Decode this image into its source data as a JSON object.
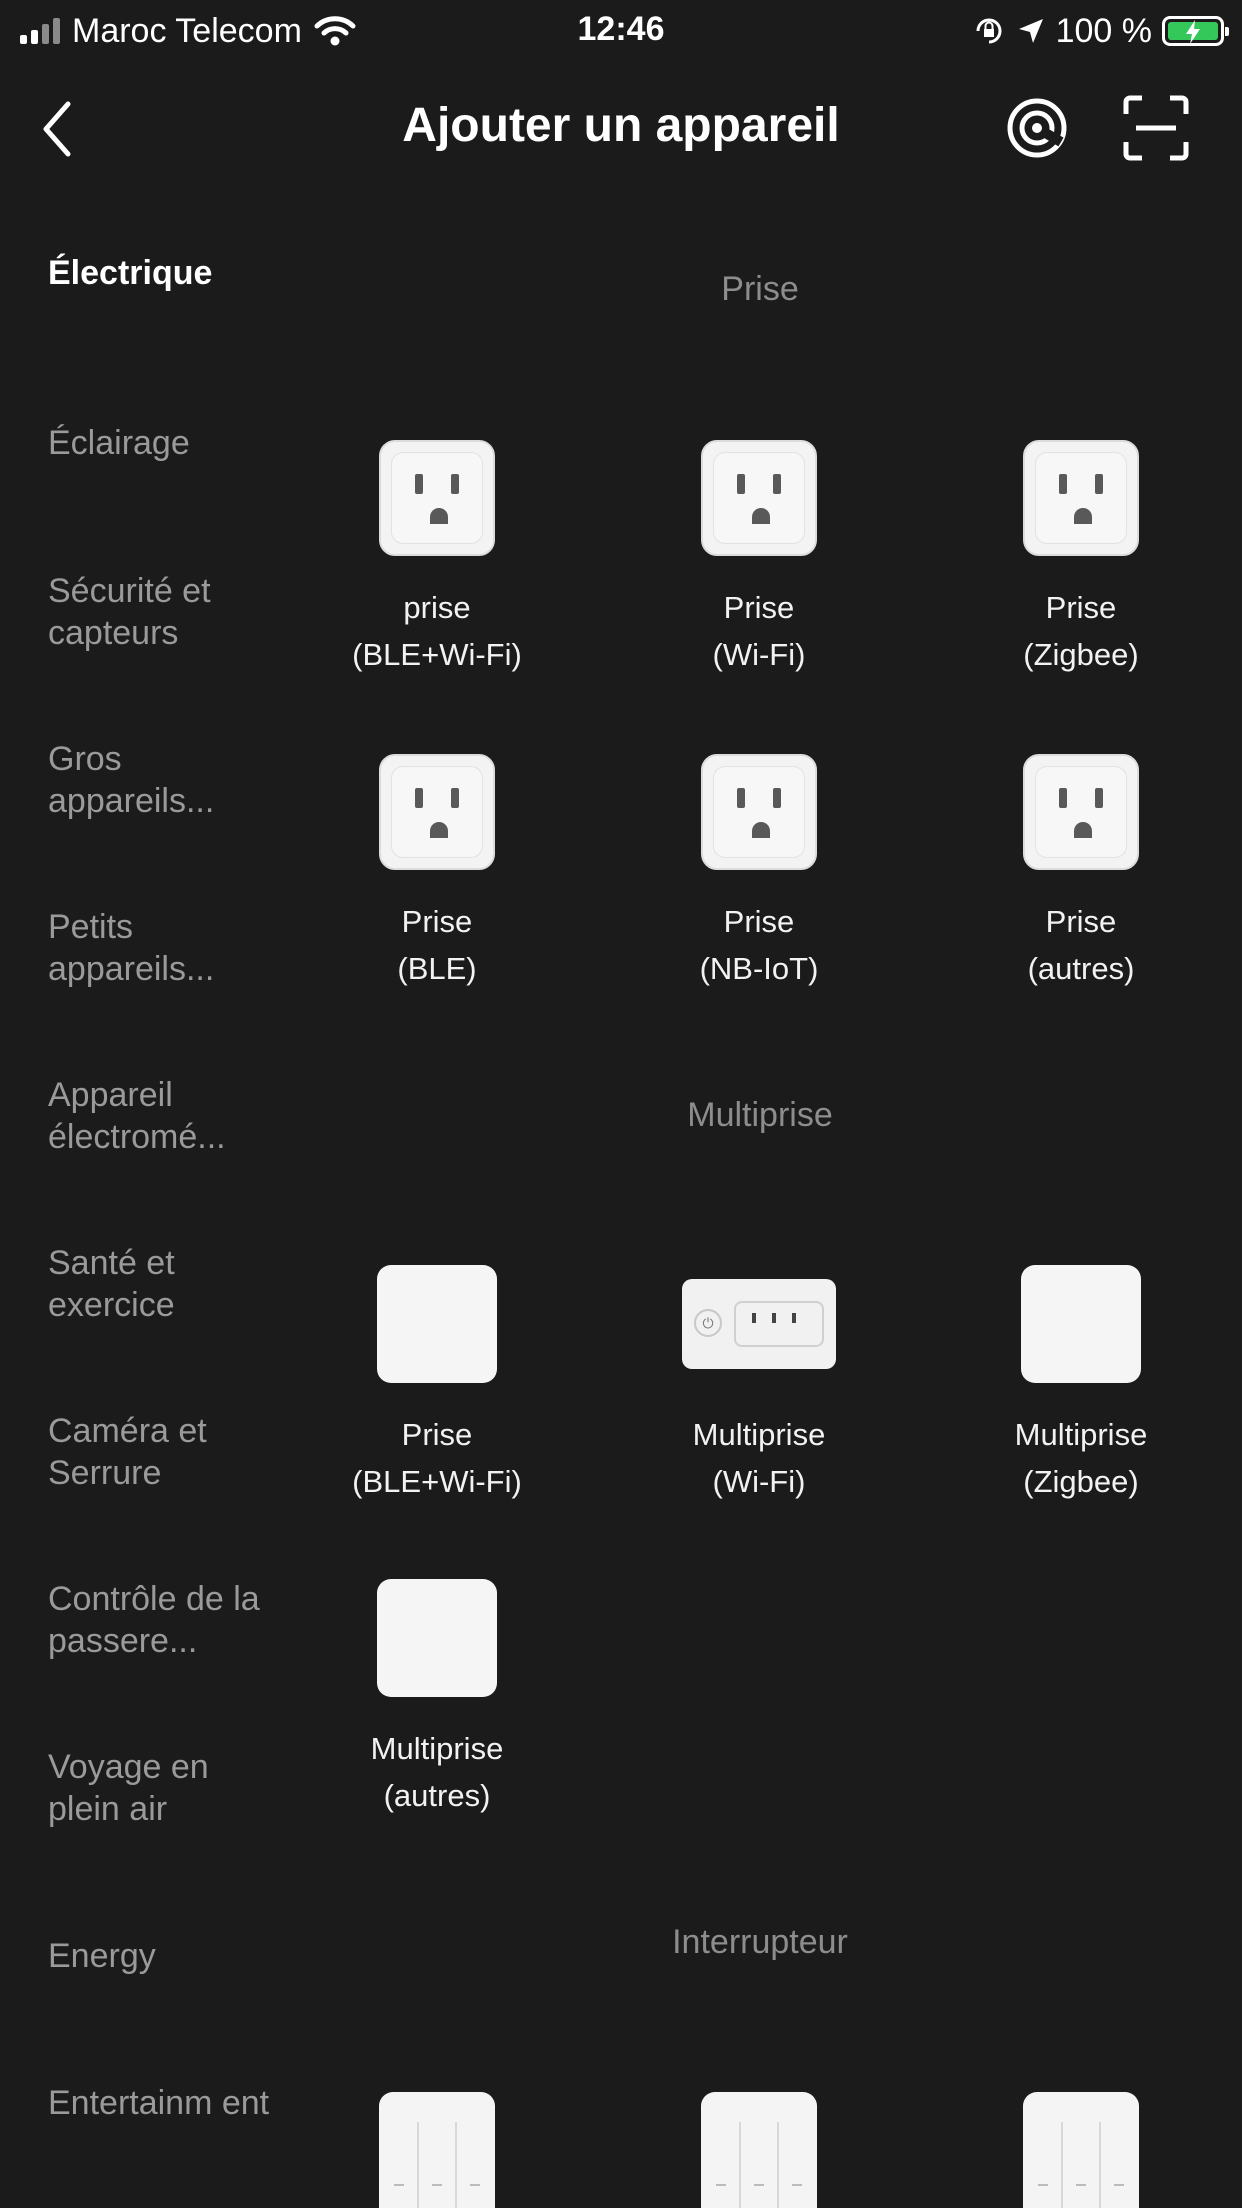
{
  "status_bar": {
    "carrier": "Maroc Telecom",
    "time": "12:46",
    "battery_text": "100 %",
    "icons": [
      "signal-icon",
      "wifi-icon",
      "orientation-lock-icon",
      "location-arrow-icon",
      "battery-charging-icon"
    ]
  },
  "nav": {
    "title": "Ajouter un appareil",
    "back_icon": "chevron-left-icon",
    "scan_icon": "radar-scan-icon",
    "qr_icon": "qr-scan-icon"
  },
  "sidebar": {
    "items": [
      {
        "label": "Électrique",
        "active": true
      },
      {
        "label": "Éclairage"
      },
      {
        "label": "Sécurité et capteurs"
      },
      {
        "label": "Gros appareils..."
      },
      {
        "label": "Petits appareils..."
      },
      {
        "label": "Appareil électromé..."
      },
      {
        "label": "Santé et exercice"
      },
      {
        "label": "Caméra et Serrure"
      },
      {
        "label": "Contrôle de la passere..."
      },
      {
        "label": "Voyage en plein air"
      },
      {
        "label": "Energy"
      },
      {
        "label": "Entertainm ent"
      }
    ]
  },
  "sections": [
    {
      "title": "Prise",
      "devices": [
        {
          "line1": "prise",
          "line2": "(BLE+Wi-Fi)",
          "icon": "outlet-icon"
        },
        {
          "line1": "Prise",
          "line2": "(Wi-Fi)",
          "icon": "outlet-icon"
        },
        {
          "line1": "Prise",
          "line2": "(Zigbee)",
          "icon": "outlet-icon"
        },
        {
          "line1": "Prise",
          "line2": "(BLE)",
          "icon": "outlet-icon"
        },
        {
          "line1": "Prise",
          "line2": "(NB-IoT)",
          "icon": "outlet-icon"
        },
        {
          "line1": "Prise",
          "line2": "(autres)",
          "icon": "outlet-icon"
        }
      ]
    },
    {
      "title": "Multiprise",
      "devices": [
        {
          "line1": "Prise",
          "line2": "(BLE+Wi-Fi)",
          "icon": "blank-device-icon"
        },
        {
          "line1": "Multiprise",
          "line2": "(Wi-Fi)",
          "icon": "power-strip-icon"
        },
        {
          "line1": "Multiprise",
          "line2": "(Zigbee)",
          "icon": "blank-device-icon"
        },
        {
          "line1": "Multiprise",
          "line2": "(autres)",
          "icon": "blank-device-icon"
        }
      ]
    },
    {
      "title": "Interrupteur",
      "devices": [
        {
          "icon": "wall-switch-icon"
        },
        {
          "icon": "wall-switch-icon"
        },
        {
          "icon": "wall-switch-icon"
        }
      ]
    }
  ]
}
